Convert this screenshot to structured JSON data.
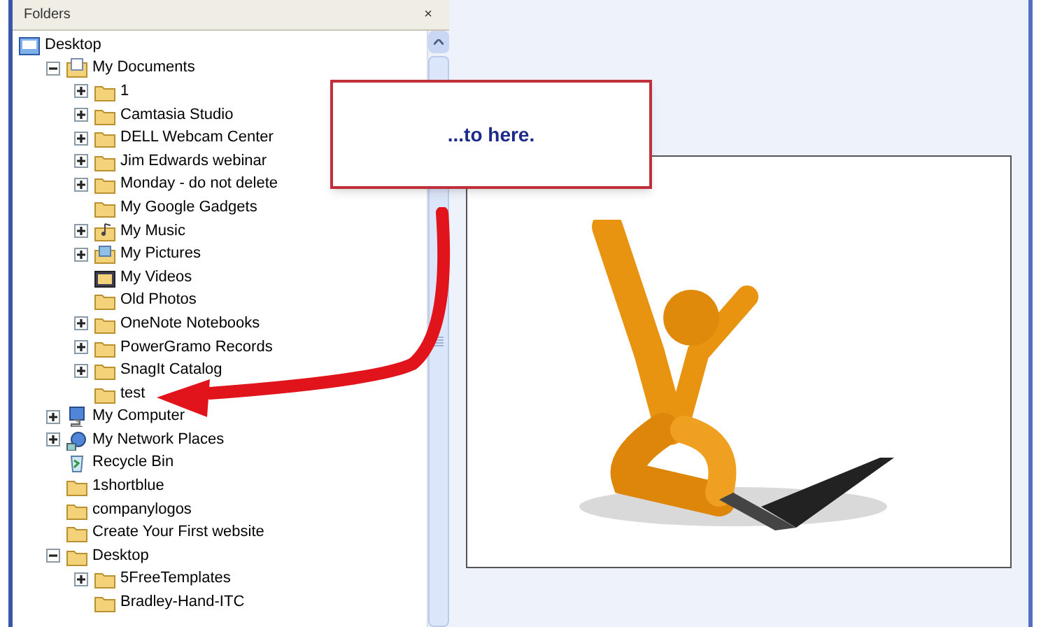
{
  "folders_pane": {
    "title": "Folders",
    "close": "×"
  },
  "tree": [
    {
      "label": "Desktop",
      "kind": "desktop",
      "has_toggle": false,
      "children": [
        {
          "label": "My Documents",
          "kind": "documents",
          "has_toggle": true,
          "expanded": true,
          "children": [
            {
              "label": "1",
              "kind": "folder",
              "has_toggle": true,
              "expanded": false
            },
            {
              "label": "Camtasia Studio",
              "kind": "folder",
              "has_toggle": true,
              "expanded": false
            },
            {
              "label": "DELL Webcam Center",
              "kind": "folder",
              "has_toggle": true,
              "expanded": false
            },
            {
              "label": "Jim Edwards webinar",
              "kind": "folder",
              "has_toggle": true,
              "expanded": false
            },
            {
              "label": "Monday - do not delete",
              "kind": "folder",
              "has_toggle": true,
              "expanded": false
            },
            {
              "label": "My Google Gadgets",
              "kind": "folder",
              "has_toggle": false
            },
            {
              "label": "My Music",
              "kind": "music",
              "has_toggle": true,
              "expanded": false
            },
            {
              "label": "My Pictures",
              "kind": "pictures",
              "has_toggle": true,
              "expanded": false
            },
            {
              "label": "My Videos",
              "kind": "videos",
              "has_toggle": false
            },
            {
              "label": "Old Photos",
              "kind": "folder",
              "has_toggle": false
            },
            {
              "label": "OneNote Notebooks",
              "kind": "folder",
              "has_toggle": true,
              "expanded": false
            },
            {
              "label": "PowerGramo Records",
              "kind": "folder",
              "has_toggle": true,
              "expanded": false
            },
            {
              "label": "SnagIt Catalog",
              "kind": "folder",
              "has_toggle": true,
              "expanded": false
            },
            {
              "label": "test",
              "kind": "folder",
              "has_toggle": false
            }
          ]
        },
        {
          "label": "My Computer",
          "kind": "computer",
          "has_toggle": true,
          "expanded": false
        },
        {
          "label": "My Network Places",
          "kind": "network",
          "has_toggle": true,
          "expanded": false
        },
        {
          "label": "Recycle Bin",
          "kind": "recycle",
          "has_toggle": false
        },
        {
          "label": "1shortblue",
          "kind": "folder",
          "has_toggle": false
        },
        {
          "label": "companylogos",
          "kind": "folder",
          "has_toggle": false
        },
        {
          "label": "Create Your First website",
          "kind": "folder",
          "has_toggle": false
        },
        {
          "label": "Desktop",
          "kind": "folder",
          "has_toggle": true,
          "expanded": true,
          "children": [
            {
              "label": "5FreeTemplates",
              "kind": "folder",
              "has_toggle": true,
              "expanded": false
            },
            {
              "label": "Bradley-Hand-ITC",
              "kind": "folder",
              "has_toggle": false
            }
          ]
        }
      ]
    }
  ],
  "callout": {
    "text": "...to here."
  }
}
